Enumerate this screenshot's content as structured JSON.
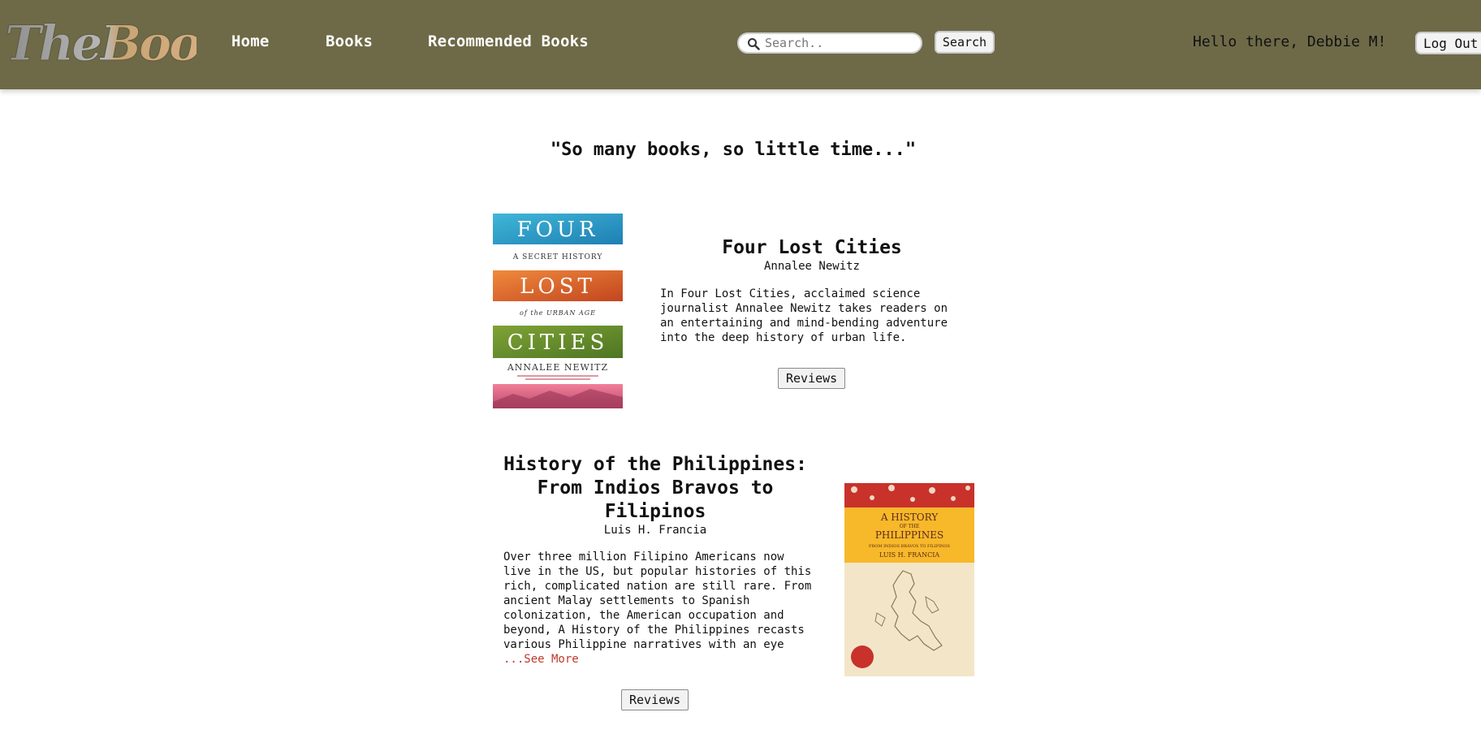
{
  "header": {
    "logo_text": "TheBook",
    "nav": {
      "home": "Home",
      "books": "Books",
      "recommended": "Recommended Books"
    },
    "search": {
      "placeholder": "Search..",
      "value": "",
      "button_label": "Search"
    },
    "greeting": "Hello there, Debbie M!",
    "logout_label": "Log Out"
  },
  "main": {
    "quote": "\"So many books, so little time...\"",
    "books": [
      {
        "title": "Four Lost Cities",
        "author": "Annalee Newitz",
        "description": "In Four Lost Cities, acclaimed science journalist Annalee Newitz takes readers on an entertaining and mind-bending adventure into the deep history of urban life.",
        "reviews_label": "Reviews",
        "cover": {
          "line1": "FOUR",
          "subtitle1": "A SECRET HISTORY",
          "line2": "LOST",
          "subtitle2": "of the URBAN AGE",
          "line3": "CITIES",
          "author": "ANNALEE NEWITZ"
        }
      },
      {
        "title": "History of the Philippines: From Indios Bravos to Filipinos",
        "author": "Luis H. Francia",
        "description": "Over three million Filipino Americans now live in the US, but popular histories of this rich, complicated nation are still rare. From ancient Malay settlements to Spanish colonization, the American occupation and beyond, A History of the Philippines recasts various Philippine narratives with an eye",
        "see_more": "...See More",
        "reviews_label": "Reviews",
        "cover": {
          "line1": "A HISTORY",
          "line2": "OF THE",
          "line3": "PHILIPPINES",
          "subtitle": "FROM INDIOS BRAVOS TO FILIPINOS",
          "author": "LUIS H. FRANCIA"
        }
      }
    ]
  },
  "colors": {
    "header_bg": "#6e6a48",
    "see_more": "#c0392b"
  }
}
